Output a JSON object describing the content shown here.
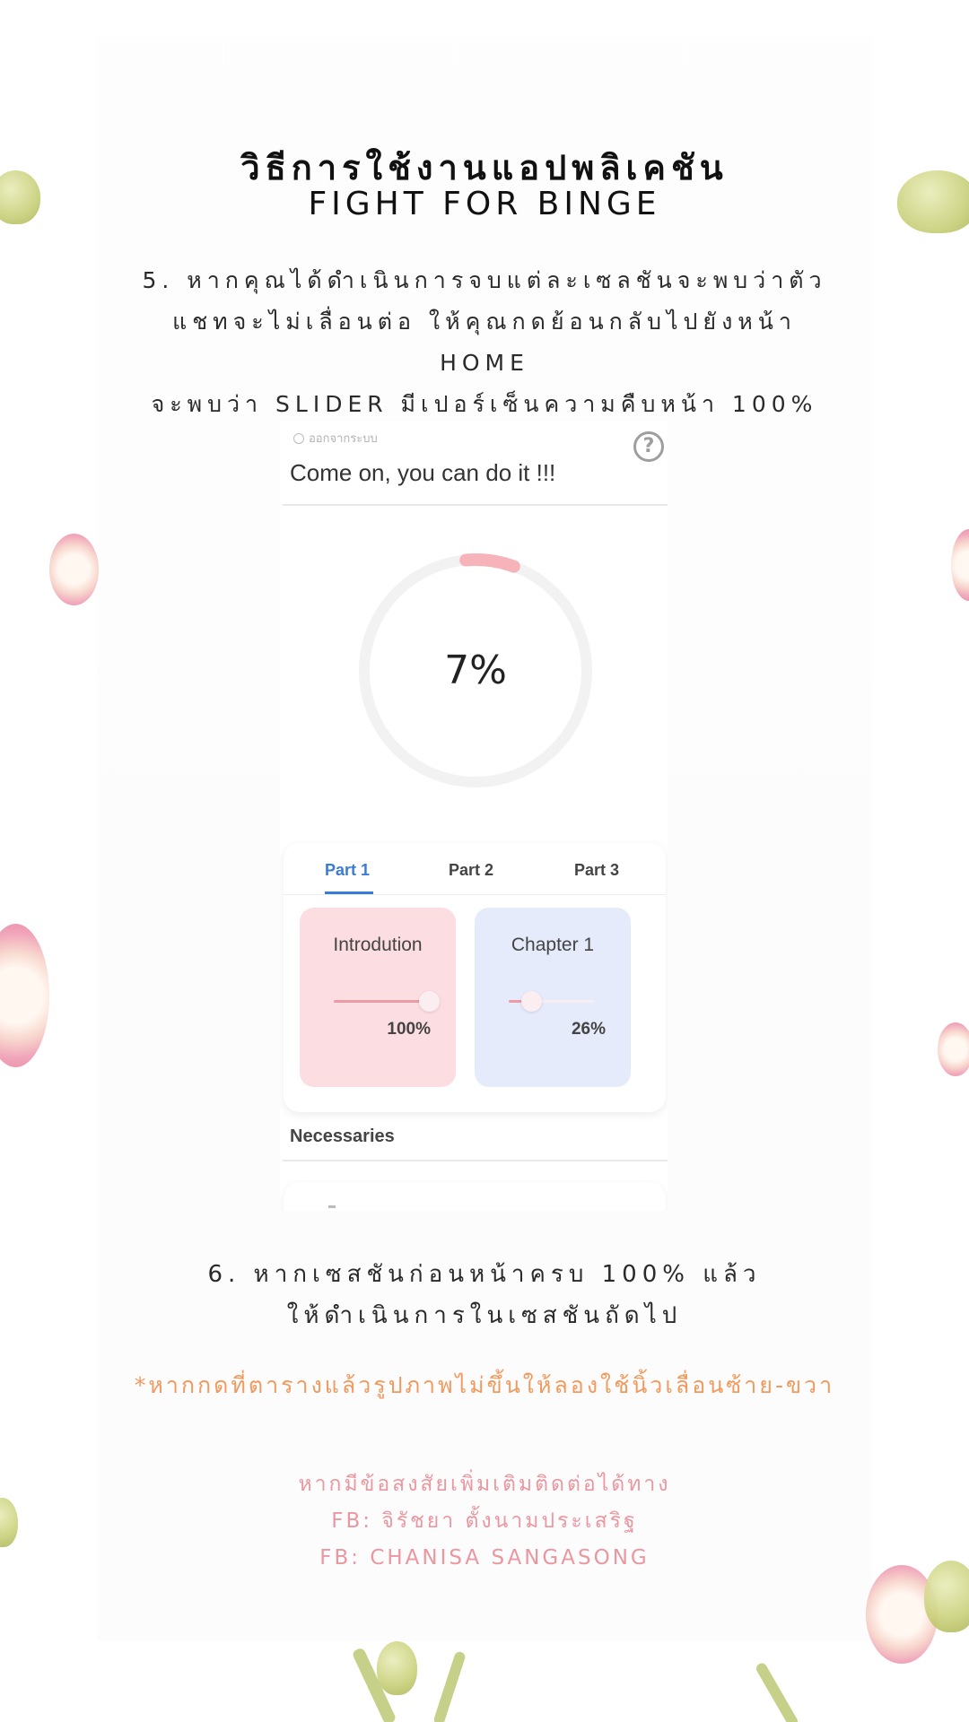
{
  "header": {
    "title_th": "วิธีการใช้งานแอปพลิเคชัน",
    "title_en": "FIGHT FOR BINGE"
  },
  "step5": {
    "line1": "5. หากคุณได้ดำเนินการจบแต่ละเซลชันจะพบว่าตัว",
    "line2": "แชทจะไม่เลื่อนต่อ ให้คุณกดย้อนกลับไปยังหน้า",
    "line3": "HOME",
    "line4": "จะพบว่า SLIDER มีเปอร์เซ็นความคืบหน้า 100%"
  },
  "app": {
    "logout_label": "ออกจากระบบ",
    "help_symbol": "?",
    "motto": "Come on, you can do it !!!",
    "overall_progress_label": "7%",
    "overall_progress": 0.07,
    "tabs": [
      "Part 1",
      "Part 2",
      "Part 3"
    ],
    "active_tab": 0,
    "tiles": [
      {
        "name": "Introdution",
        "percent_label": "100%",
        "progress": 1.0,
        "color": "#fcdde2",
        "track_color": "#ec9aa6"
      },
      {
        "name": "Chapter 1",
        "percent_label": "26%",
        "progress": 0.26,
        "color": "#e5ebfb",
        "track_color": "#ec9aa6"
      }
    ],
    "section_title": "Necessaries"
  },
  "step6": {
    "line1": "6. หากเซสชันก่อนหน้าครบ 100% แล้ว",
    "line2": "ให้ดำเนินการในเซสชันถัดไป"
  },
  "note": "*หากกดที่ตารางแล้วรูปภาพไม่ขึ้นให้ลองใช้นิ้วเลื่อนซ้าย-ขวา",
  "contact": {
    "line1": "หากมีข้อสงสัยเพิ่มเติมติดต่อได้ทาง",
    "line2": "FB: จิรัชยา ตั้งนามประเสริฐ",
    "line3": "FB: CHANISA SANGASONG"
  },
  "colors": {
    "accent_blue": "#3a7bd5",
    "ring_track": "#f2f2f2",
    "ring_fill": "#f7b3ba",
    "note_orange": "#f29a5e",
    "contact_pink": "#ea97a0"
  }
}
